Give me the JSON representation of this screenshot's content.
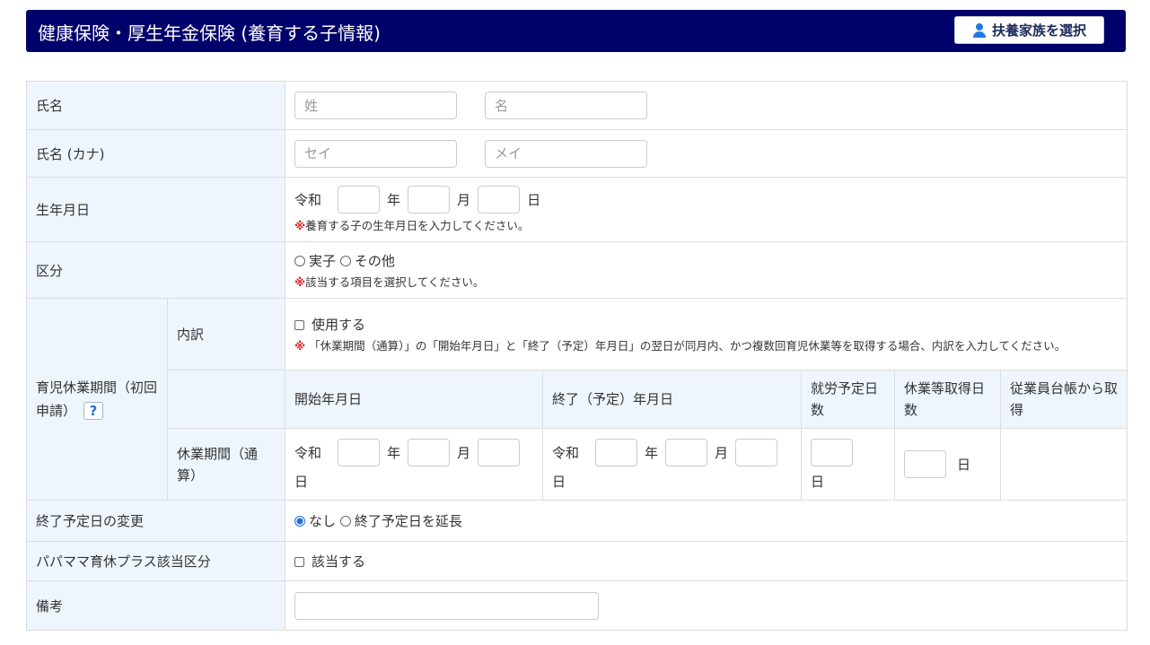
{
  "header": {
    "title": "健康保険・厚生年金保険 (養育する子情報)",
    "select_button": "扶養家族を選択"
  },
  "fields": {
    "name": {
      "label": "氏名",
      "last_placeholder": "姓",
      "first_placeholder": "名"
    },
    "kana": {
      "label": "氏名 (カナ)",
      "last_placeholder": "セイ",
      "first_placeholder": "メイ"
    },
    "birth": {
      "label": "生年月日",
      "era": "令和",
      "year": "年",
      "month": "月",
      "day": "日",
      "note": "養育する子の生年月日を入力してください。"
    },
    "category": {
      "label": "区分",
      "options": [
        "実子",
        "その他"
      ],
      "note": "該当する項目を選択してください。"
    },
    "leave": {
      "label": "育児休業期間（初回申請）",
      "help": "?",
      "breakdown_label": "内訳",
      "breakdown_check": "使用する",
      "breakdown_note": "「休業期間（通算）」の「開始年月日」と「終了（予定）年月日」の翌日が同月内、かつ複数回育児休業等を取得する場合、内訳を入力してください。",
      "columns": [
        "開始年月日",
        "終了（予定）年月日",
        "就労予定日数",
        "休業等取得日数",
        "従業員台帳から取得"
      ],
      "total_label": "休業期間（通算）",
      "day_unit": "日"
    },
    "end_change": {
      "label": "終了予定日の変更",
      "options": [
        "なし",
        "終了予定日を延長"
      ],
      "selected": "なし"
    },
    "papa_mama": {
      "label": "パパママ育休プラス該当区分",
      "check": "該当する"
    },
    "remarks": {
      "label": "備考"
    }
  },
  "note_mark": "※"
}
